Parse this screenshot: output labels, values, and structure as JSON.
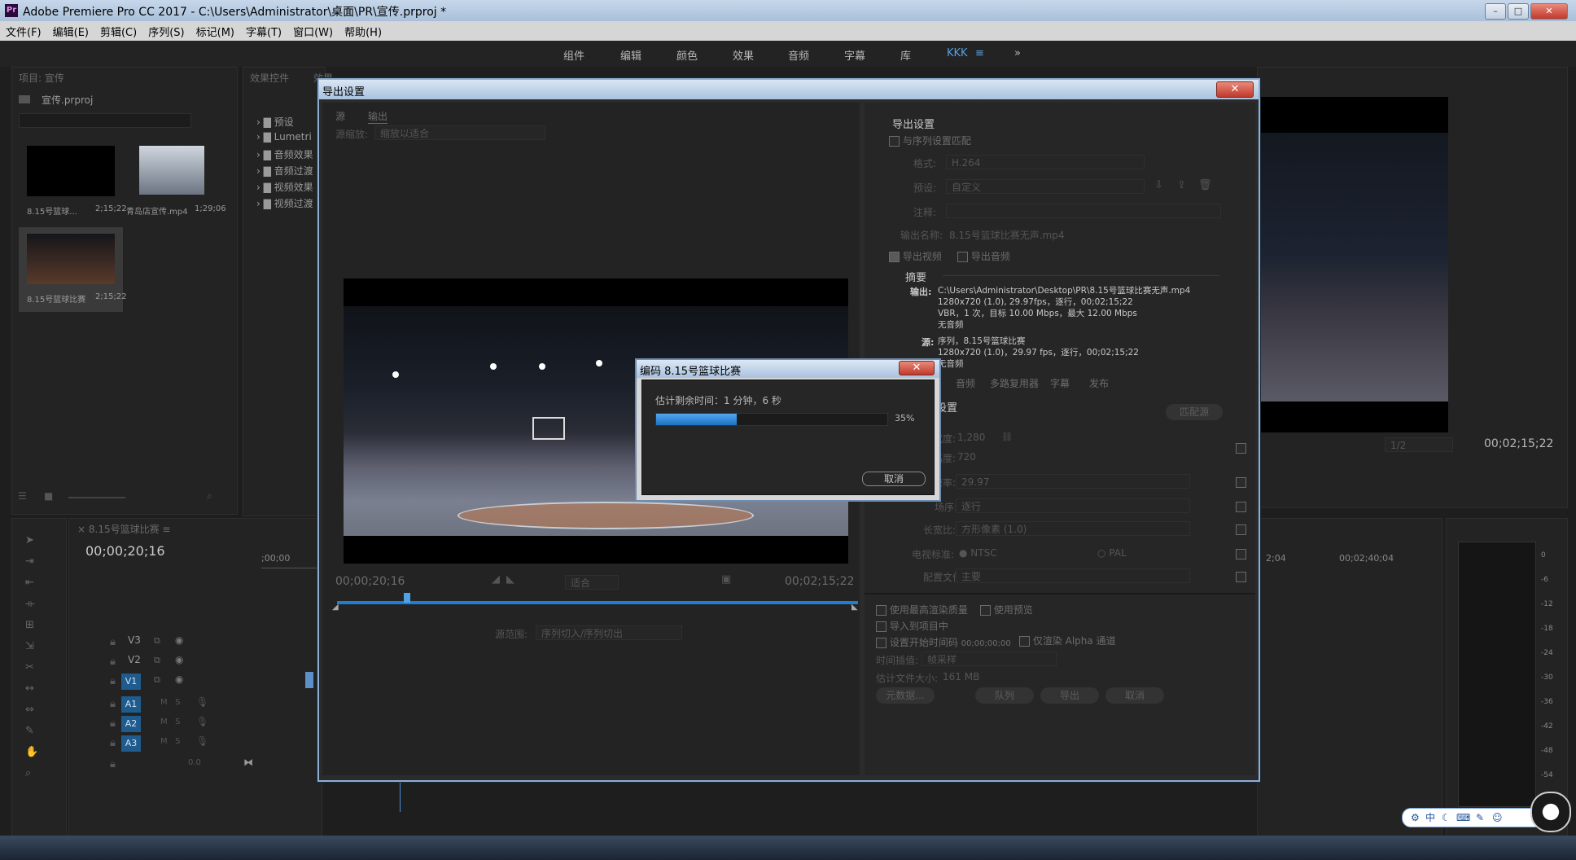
{
  "app": {
    "title": "Adobe Premiere Pro CC 2017 - C:\\Users\\Administrator\\桌面\\PR\\宣传.prproj *",
    "icon_text": "Pr"
  },
  "menu": [
    "文件(F)",
    "编辑(E)",
    "剪辑(C)",
    "序列(S)",
    "标记(M)",
    "字幕(T)",
    "窗口(W)",
    "帮助(H)"
  ],
  "workspaces": [
    "组件",
    "编辑",
    "颜色",
    "效果",
    "音频",
    "字幕",
    "库",
    "KKK",
    "≡",
    "»"
  ],
  "project_panel": {
    "tab": "项目: 宣传",
    "file": "宣传.prproj",
    "items": [
      {
        "name": "8.15号篮球...",
        "duration": "2;15;22"
      },
      {
        "name": "青岛店宣传.mp4",
        "duration": "1;29;06"
      },
      {
        "name": "8.15号篮球比赛",
        "duration": "2;15;22"
      }
    ]
  },
  "effects_panel": {
    "tab1": "效果控件",
    "tab2": "效果",
    "folders": [
      "预设",
      "Lumetri",
      "音频效果",
      "音频过渡",
      "视频效果",
      "视频过渡"
    ]
  },
  "program_monitor": {
    "timecode": "00;02;15;22",
    "zoom": "1/2"
  },
  "timeline": {
    "tab": "8.15号篮球比赛",
    "timecode": "00;00;20;16",
    "ruler": [
      ";00;00",
      "2;04",
      "00;02;40;04"
    ],
    "video_tracks": [
      "V3",
      "V2",
      "V1"
    ],
    "audio_tracks": [
      "A1",
      "A2",
      "A3"
    ],
    "master": "0.0"
  },
  "meter_scale": [
    "0",
    "-6",
    "-12",
    "-18",
    "-24",
    "-30",
    "-36",
    "-42",
    "-48",
    "-54"
  ],
  "export_dialog": {
    "title": "导出设置",
    "tabs": [
      "源",
      "输出"
    ],
    "source_scaling_label": "源缩放:",
    "source_scaling_value": "缩放以适合",
    "start_tc": "00;00;20;16",
    "end_tc": "00;02;15;22",
    "fit": "适合",
    "range_label": "源范围:",
    "range_value": "序列切入/序列切出",
    "section_title": "导出设置",
    "match_sequence": "与序列设置匹配",
    "format_label": "格式:",
    "format_value": "H.264",
    "preset_label": "预设:",
    "preset_value": "自定义",
    "comment_label": "注释:",
    "output_name_label": "输出名称:",
    "output_name_value": "8.15号篮球比赛无声.mp4",
    "export_video": "导出视频",
    "export_audio": "导出音频",
    "summary_title": "摘要",
    "summary_output_label": "输出:",
    "summary_output_lines": [
      "C:\\Users\\Administrator\\Desktop\\PR\\8.15号篮球比赛无声.mp4",
      "1280x720 (1.0), 29.97fps，逐行，00;02;15;22",
      "VBR，1 次，目标 10.00 Mbps，最大 12.00 Mbps",
      "无音频"
    ],
    "summary_source_label": "源:",
    "summary_source_lines": [
      "序列，8.15号篮球比赛",
      "1280x720 (1.0)，29.97 fps，逐行，00;02;15;22",
      "无音频"
    ],
    "lower_tabs": [
      "音频",
      "多路复用器",
      "字幕",
      "发布"
    ],
    "basic_title": "设置",
    "match_source_btn": "匹配源",
    "width_label": "宽度:",
    "width_value": "1,280",
    "height_label": "高度:",
    "height_value": "720",
    "fps_label": "帧速率:",
    "fps_value": "29.97",
    "field_label": "场序:",
    "field_value": "逐行",
    "aspect_label": "长宽比:",
    "aspect_value": "方形像素 (1.0)",
    "tv_label": "电视标准:",
    "tv_ntsc": "NTSC",
    "tv_pal": "PAL",
    "profile_label": "配置文件:",
    "profile_value": "主要",
    "opt_max_quality": "使用最高渲染质量",
    "opt_preview": "使用预览",
    "opt_import": "导入到项目中",
    "opt_start_tc": "设置开始时间码",
    "opt_start_tc_value": "00;00;00;00",
    "opt_alpha": "仅渲染 Alpha 通道",
    "interp_label": "时间插值:",
    "interp_value": "帧采样",
    "filesize_label": "估计文件大小:",
    "filesize_value": "161 MB",
    "btn_metadata": "元数据...",
    "btn_queue": "队列",
    "btn_export": "导出",
    "btn_cancel": "取消"
  },
  "encode_dialog": {
    "title": "编码 8.15号篮球比赛",
    "remaining": "估计剩余时间：1 分钟，6 秒",
    "progress": 0.35,
    "progress_text": "35%",
    "cancel": "取消"
  },
  "tray": {
    "ime": "中"
  }
}
